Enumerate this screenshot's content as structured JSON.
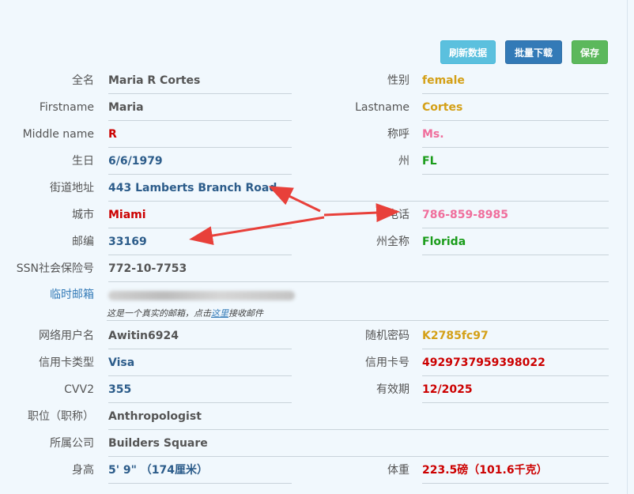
{
  "toolbar": {
    "refresh_label": "刷新数据",
    "batch_label": "批量下载",
    "save_label": "保存"
  },
  "fields": {
    "fullname": {
      "label": "全名",
      "value": "Maria R Cortes"
    },
    "gender": {
      "label": "性别",
      "value": "female"
    },
    "firstname": {
      "label": "Firstname",
      "value": "Maria"
    },
    "lastname": {
      "label": "Lastname",
      "value": "Cortes"
    },
    "middlename": {
      "label": "Middle name",
      "value": "R"
    },
    "title": {
      "label": "称呼",
      "value": "Ms."
    },
    "birthday": {
      "label": "生日",
      "value": "6/6/1979"
    },
    "state": {
      "label": "州",
      "value": "FL"
    },
    "street": {
      "label": "街道地址",
      "value": "443 Lamberts Branch Road"
    },
    "city": {
      "label": "城市",
      "value": "Miami"
    },
    "phone": {
      "label": "电话",
      "value": "786-859-8985"
    },
    "zip": {
      "label": "邮编",
      "value": "33169"
    },
    "state_full": {
      "label": "州全称",
      "value": "Florida"
    },
    "ssn": {
      "label": "SSN社会保险号",
      "value": "772-10-7753"
    },
    "temp_email": {
      "label": "临时邮箱"
    },
    "username": {
      "label": "网络用户名",
      "value": "Awitin6924"
    },
    "password": {
      "label": "随机密码",
      "value": "K2785fc97"
    },
    "card_type": {
      "label": "信用卡类型",
      "value": "Visa"
    },
    "card_number": {
      "label": "信用卡号",
      "value": "4929737959398022"
    },
    "cvv2": {
      "label": "CVV2",
      "value": "355"
    },
    "expiry": {
      "label": "有效期",
      "value": "12/2025"
    },
    "occupation": {
      "label": "职位（职称）",
      "value": "Anthropologist"
    },
    "company": {
      "label": "所属公司",
      "value": "Builders Square"
    },
    "height": {
      "label": "身高",
      "value": "5' 9\"  （174厘米）"
    },
    "weight": {
      "label": "体重",
      "value": "223.5磅（101.6千克）"
    }
  },
  "email_note": {
    "prefix": "这是一个真实的邮箱，点击",
    "link": "这里",
    "suffix": "接收邮件"
  },
  "colors": {
    "arrow": "#e8403a"
  }
}
